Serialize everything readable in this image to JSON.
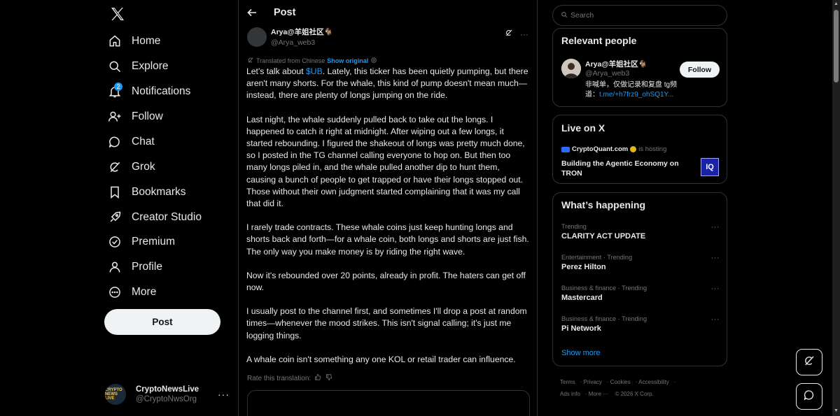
{
  "nav": {
    "items": [
      {
        "label": "Home",
        "icon": "home-icon"
      },
      {
        "label": "Explore",
        "icon": "search-icon"
      },
      {
        "label": "Notifications",
        "icon": "bell-icon",
        "badge": "2"
      },
      {
        "label": "Follow",
        "icon": "follow-icon"
      },
      {
        "label": "Chat",
        "icon": "chat-icon"
      },
      {
        "label": "Grok",
        "icon": "grok-icon"
      },
      {
        "label": "Bookmarks",
        "icon": "bookmark-icon"
      },
      {
        "label": "Creator Studio",
        "icon": "rocket-icon"
      },
      {
        "label": "Premium",
        "icon": "premium-icon"
      },
      {
        "label": "Profile",
        "icon": "profile-icon"
      },
      {
        "label": "More",
        "icon": "more-circle-icon"
      }
    ],
    "post_button": "Post"
  },
  "account": {
    "name": "CryptoNewsLive",
    "handle": "@CryptoNwsOrg",
    "avatar_text": "CRYPTO NEWS LIVE"
  },
  "post": {
    "header_title": "Post",
    "author_name": "Arya@羊姐社区🐐",
    "author_handle": "@Arya_web3",
    "translated_label": "Translated from Chinese",
    "show_original": "Show original",
    "paragraphs": [
      {
        "before": "Let's talk about ",
        "cashtag": "$UB",
        "after": ". Lately, this ticker has been quietly pumping, but there aren't many shorts. For the whale, this kind of pump doesn't mean much—instead, there are plenty of longs jumping on the ride."
      },
      {
        "text": "Last night, the whale suddenly pulled back to take out the longs. I happened to catch it right at midnight. After wiping out a few longs, it started rebounding. I figured the shakeout of longs was pretty much done, so I posted in the TG channel calling everyone to hop on. But then too many longs piled in, and the whale pulled another dip to hunt them, causing a bunch of people to get trapped or have their longs stopped out. Those without their own judgment started complaining that it was my call that did it."
      },
      {
        "text": "I rarely trade contracts. These whale coins just keep hunting longs and shorts back and forth—for a whale coin, both longs and shorts are just fish. The only way you make money is by riding the right wave."
      },
      {
        "text": "Now it's rebounded over 20 points, already in profit. The haters can get off now."
      },
      {
        "text": "I usually post to the channel first, and sometimes I'll drop a post at random times—whenever the mood strikes. This isn't signal calling; it's just me logging things."
      },
      {
        "text": "A whale coin isn't something any one KOL or retail trader can influence."
      }
    ],
    "rate_translation": "Rate this translation:"
  },
  "right": {
    "search_placeholder": "Search",
    "relevant_people": {
      "title": "Relevant people",
      "name": "Arya@羊姐社区🐐",
      "handle": "@Arya_web3",
      "bio_text": "非喊单，仅做记录和复盘 tg频道：",
      "bio_link": "t.me/+h7frz9_ohSQ1Y...",
      "follow_label": "Follow"
    },
    "live": {
      "title": "Live on X",
      "host_name": "CryptoQuant.com",
      "host_text": "is hosting",
      "space_title": "Building the Agentic Economy on TRON",
      "thumb_text": "IQ"
    },
    "happening": {
      "title": "What’s happening",
      "trends": [
        {
          "meta": "Trending",
          "name": "CLARITY ACT UPDATE"
        },
        {
          "meta": "Entertainment · Trending",
          "name": "Perez Hilton"
        },
        {
          "meta": "Business & finance · Trending",
          "name": "Mastercard"
        },
        {
          "meta": "Business & finance · Trending",
          "name": "Pi Network"
        }
      ],
      "show_more": "Show more"
    },
    "footer": {
      "links": [
        "Terms",
        "Privacy",
        "Cookies",
        "Accessibility",
        "Ads info",
        "More ···"
      ],
      "copyright": "© 2026 X Corp."
    }
  }
}
